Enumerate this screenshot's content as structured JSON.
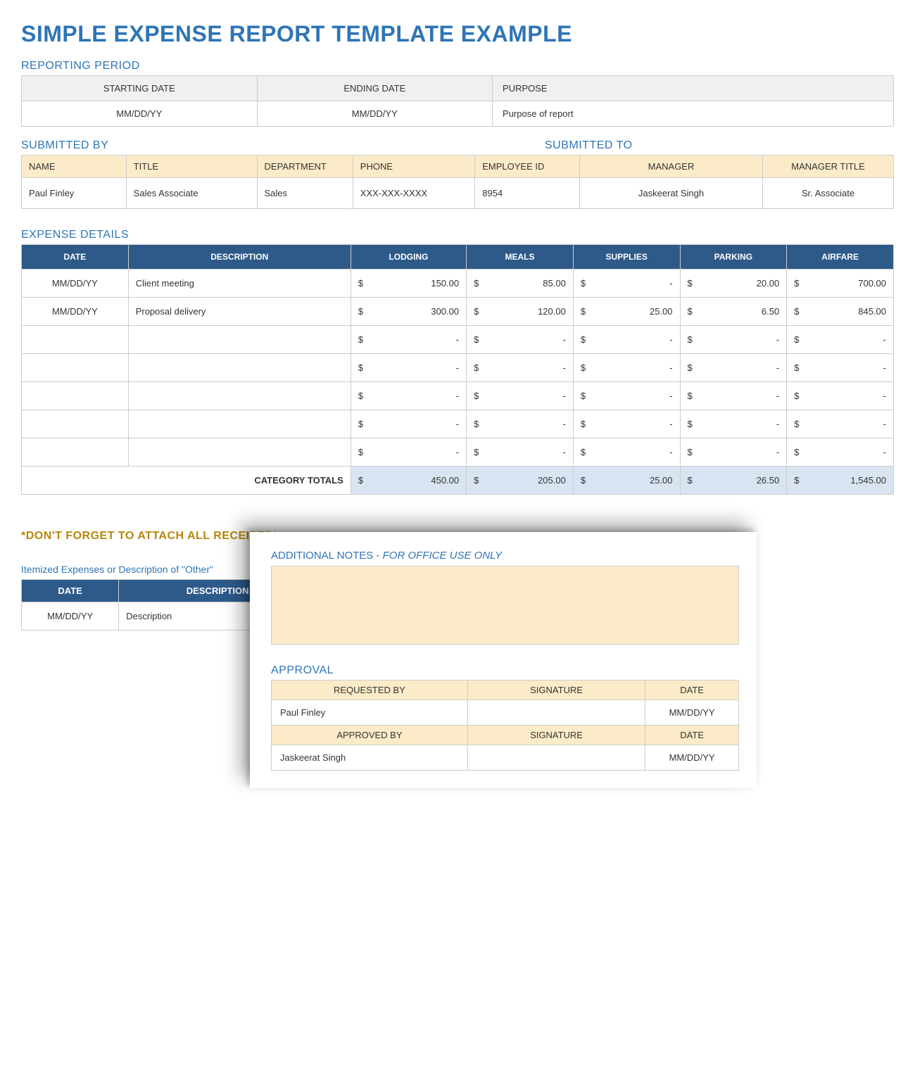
{
  "title": "SIMPLE EXPENSE REPORT TEMPLATE EXAMPLE",
  "sections": {
    "reporting_period": "REPORTING PERIOD",
    "submitted_by": "SUBMITTED BY",
    "submitted_to": "SUBMITTED TO",
    "expense_details": "EXPENSE DETAILS",
    "receipts_reminder": "*DON'T FORGET TO ATTACH ALL RECEIPTS*",
    "itemized_label": "Itemized Expenses or Description of \"Other\"",
    "additional_notes_prefix": "ADDITIONAL NOTES - ",
    "additional_notes_italic": "FOR OFFICE USE ONLY",
    "approval": "APPROVAL"
  },
  "period": {
    "headers": {
      "start": "STARTING DATE",
      "end": "ENDING DATE",
      "purpose": "PURPOSE"
    },
    "values": {
      "start": "MM/DD/YY",
      "end": "MM/DD/YY",
      "purpose": "Purpose of report"
    }
  },
  "submitted": {
    "headers": {
      "name": "NAME",
      "title": "TITLE",
      "dept": "DEPARTMENT",
      "phone": "PHONE",
      "empid": "EMPLOYEE ID",
      "manager": "MANAGER",
      "mgr_title": "MANAGER TITLE"
    },
    "values": {
      "name": "Paul Finley",
      "title": "Sales Associate",
      "dept": "Sales",
      "phone": "XXX-XXX-XXXX",
      "empid": "8954",
      "manager": "Jaskeerat Singh",
      "mgr_title": "Sr. Associate"
    }
  },
  "expense": {
    "headers": {
      "date": "DATE",
      "desc": "DESCRIPTION",
      "lodging": "LODGING",
      "meals": "MEALS",
      "supplies": "SUPPLIES",
      "parking": "PARKING",
      "airfare": "AIRFARE"
    },
    "rows": [
      {
        "date": "MM/DD/YY",
        "desc": "Client meeting",
        "lodging": "150.00",
        "meals": "85.00",
        "supplies": "-",
        "parking": "20.00",
        "airfare": "700.00"
      },
      {
        "date": "MM/DD/YY",
        "desc": "Proposal delivery",
        "lodging": "300.00",
        "meals": "120.00",
        "supplies": "25.00",
        "parking": "6.50",
        "airfare": "845.00"
      },
      {
        "date": "",
        "desc": "",
        "lodging": "-",
        "meals": "-",
        "supplies": "-",
        "parking": "-",
        "airfare": "-"
      },
      {
        "date": "",
        "desc": "",
        "lodging": "-",
        "meals": "-",
        "supplies": "-",
        "parking": "-",
        "airfare": "-"
      },
      {
        "date": "",
        "desc": "",
        "lodging": "-",
        "meals": "-",
        "supplies": "-",
        "parking": "-",
        "airfare": "-"
      },
      {
        "date": "",
        "desc": "",
        "lodging": "-",
        "meals": "-",
        "supplies": "-",
        "parking": "-",
        "airfare": "-"
      },
      {
        "date": "",
        "desc": "",
        "lodging": "-",
        "meals": "-",
        "supplies": "-",
        "parking": "-",
        "airfare": "-"
      }
    ],
    "totals_label": "CATEGORY TOTALS",
    "totals": {
      "lodging": "450.00",
      "meals": "205.00",
      "supplies": "25.00",
      "parking": "26.50",
      "airfare": "1,545.00"
    }
  },
  "itemized": {
    "headers": {
      "date": "DATE",
      "desc": "DESCRIPTION"
    },
    "row": {
      "date": "MM/DD/YY",
      "desc": "Description"
    }
  },
  "approval": {
    "headers": {
      "req": "REQUESTED BY",
      "sig": "SIGNATURE",
      "date": "DATE",
      "app": "APPROVED BY"
    },
    "requested": {
      "name": "Paul Finley",
      "date": "MM/DD/YY"
    },
    "approved": {
      "name": "Jaskeerat Singh",
      "date": "MM/DD/YY"
    }
  }
}
